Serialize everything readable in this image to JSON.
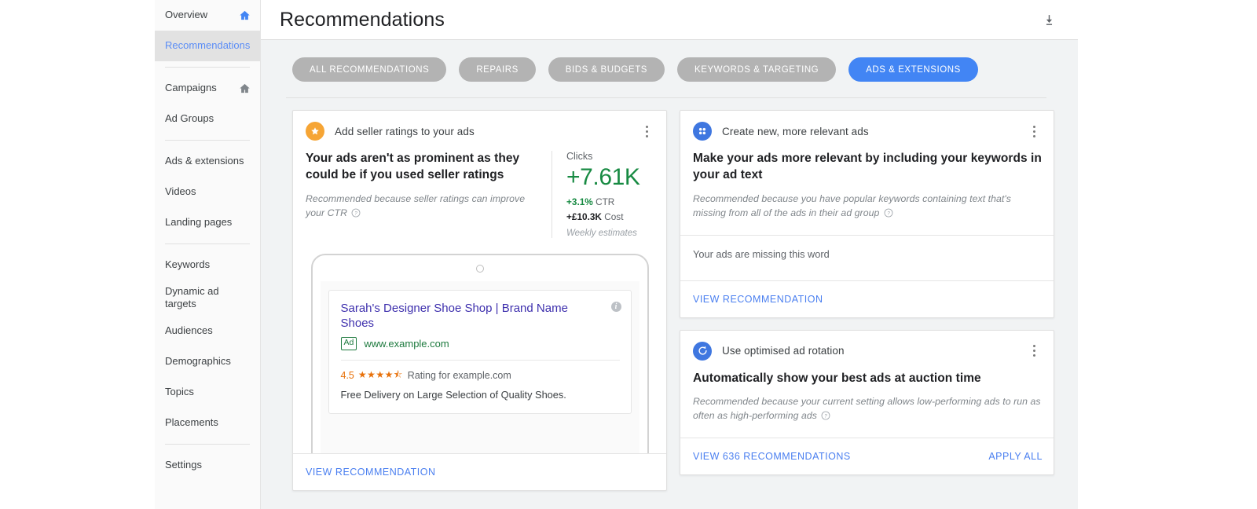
{
  "sidebar": {
    "items": [
      {
        "label": "Overview",
        "icon": "home-icon",
        "active": false,
        "has_icon": true
      },
      {
        "label": "Recommendations",
        "icon": "",
        "active": true,
        "has_icon": false
      },
      {
        "sep": true
      },
      {
        "label": "Campaigns",
        "icon": "home-icon",
        "active": false,
        "has_icon": true
      },
      {
        "label": "Ad Groups",
        "icon": "",
        "active": false,
        "has_icon": false
      },
      {
        "sep": true
      },
      {
        "label": "Ads & extensions",
        "icon": "",
        "active": false,
        "has_icon": false
      },
      {
        "label": "Videos",
        "icon": "",
        "active": false,
        "has_icon": false
      },
      {
        "label": "Landing pages",
        "icon": "",
        "active": false,
        "has_icon": false
      },
      {
        "sep": true
      },
      {
        "label": "Keywords",
        "icon": "",
        "active": false,
        "has_icon": false
      },
      {
        "label": "Dynamic ad targets",
        "icon": "",
        "active": false,
        "has_icon": false
      },
      {
        "label": "Audiences",
        "icon": "",
        "active": false,
        "has_icon": false
      },
      {
        "label": "Demographics",
        "icon": "",
        "active": false,
        "has_icon": false
      },
      {
        "label": "Topics",
        "icon": "",
        "active": false,
        "has_icon": false
      },
      {
        "label": "Placements",
        "icon": "",
        "active": false,
        "has_icon": false
      },
      {
        "sep": true
      },
      {
        "label": "Settings",
        "icon": "",
        "active": false,
        "has_icon": false
      }
    ]
  },
  "header": {
    "title": "Recommendations",
    "download_icon": "download-icon"
  },
  "filters": {
    "chips": [
      {
        "label": "ALL RECOMMENDATIONS",
        "selected": false
      },
      {
        "label": "REPAIRS",
        "selected": false
      },
      {
        "label": "BIDS & BUDGETS",
        "selected": false
      },
      {
        "label": "KEYWORDS & TARGETING",
        "selected": false
      },
      {
        "label": "ADS & EXTENSIONS",
        "selected": true
      }
    ]
  },
  "cards": {
    "seller_ratings": {
      "icon": "star-icon",
      "kicker": "Add seller ratings to your ads",
      "title": "Your ads aren't as prominent as they could be if you used seller ratings",
      "reason": "Recommended because seller ratings can improve your CTR",
      "stats": {
        "metric_label": "Clicks",
        "metric_value": "+7.61K",
        "ctr_value": "+3.1%",
        "ctr_label": "CTR",
        "cost_value": "+£10.3K",
        "cost_label": "Cost",
        "note": "Weekly estimates"
      },
      "preview": {
        "ad_title": "Sarah's Designer Shoe Shop | Brand Name Shoes",
        "ad_tag": "Ad",
        "ad_url": "www.example.com",
        "rating_number": "4.5",
        "rating_stars": "★★★★⯪",
        "rating_text": "Rating for example.com",
        "description": "Free Delivery on Large Selection of Quality Shoes.",
        "info_icon": "info-icon"
      },
      "action": "VIEW RECOMMENDATION"
    },
    "relevant_ads": {
      "icon": "grid-dots-icon",
      "kicker": "Create new, more relevant ads",
      "title": "Make your ads more relevant by including your keywords in your ad text",
      "reason": "Recommended because you have popular keywords containing text that's missing from all of the ads in their ad group",
      "subsection": "Your ads are missing this word",
      "action": "VIEW RECOMMENDATION"
    },
    "ad_rotation": {
      "icon": "refresh-icon",
      "kicker": "Use optimised ad rotation",
      "title": "Automatically show your best ads at auction time",
      "reason": "Recommended because your current setting allows low-performing ads to run as often as high-performing ads",
      "action_primary": "VIEW 636 RECOMMENDATIONS",
      "action_secondary": "APPLY ALL"
    }
  },
  "colors": {
    "accent_blue": "#4285f4",
    "link_blue": "#4a7ff0",
    "positive_green": "#178a42",
    "star_orange": "#f6a535",
    "badge_blue": "#3f77e0"
  }
}
